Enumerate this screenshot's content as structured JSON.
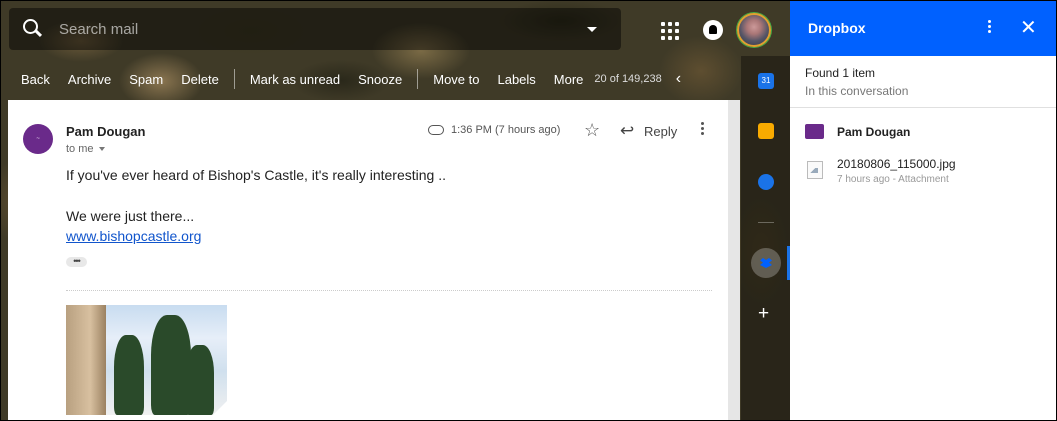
{
  "search": {
    "placeholder": "Search mail"
  },
  "toolbar": {
    "back": "Back",
    "archive": "Archive",
    "spam": "Spam",
    "delete": "Delete",
    "mark_unread": "Mark as unread",
    "snooze": "Snooze",
    "move_to": "Move to",
    "labels": "Labels",
    "more": "More",
    "count": "20 of 149,238"
  },
  "email": {
    "sender": "Pam Dougan",
    "to": "to me",
    "time": "1:36 PM (7 hours ago)",
    "reply": "Reply",
    "line1": "If you've ever heard of Bishop's Castle, it's really interesting ..",
    "line2": "We were just there...",
    "link": "www.bishopcastle.org",
    "ellipsis": "•••"
  },
  "side": {
    "calendar_day": "31"
  },
  "panel": {
    "title": "Dropbox",
    "found": "Found 1 item",
    "scope": "In this conversation",
    "sender": "Pam Dougan",
    "file_name": "20180806_115000.jpg",
    "file_meta": "7 hours ago - Attachment"
  },
  "colors": {
    "dropbox_blue": "#0061ff",
    "link": "#1155cc",
    "avatar_purple": "#6a2a8a"
  }
}
